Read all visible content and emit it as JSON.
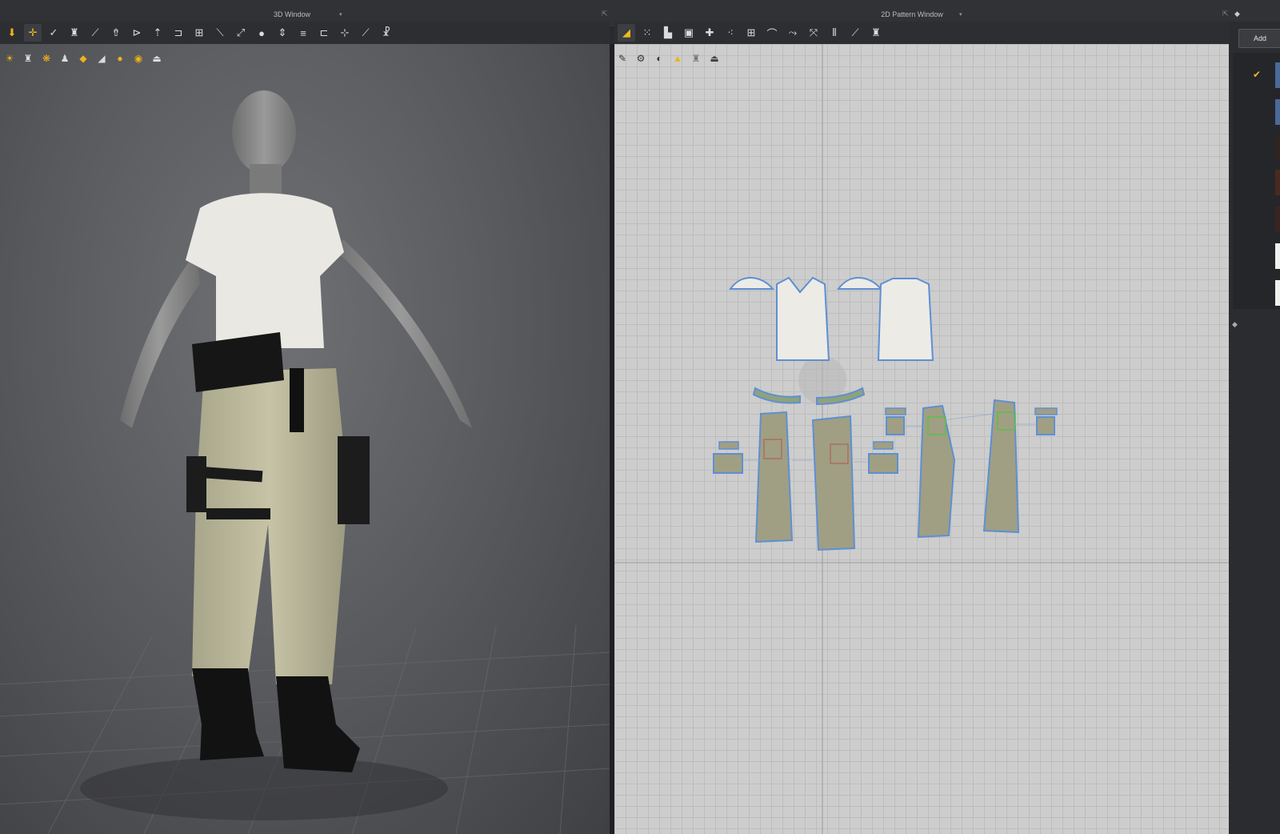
{
  "window_titles": {
    "left": "3D Window",
    "right": "2D Pattern Window"
  },
  "toolbar_3d": [
    "move-icon",
    "select-icon",
    "pen-icon",
    "garment-icon",
    "line-icon",
    "fold-icon",
    "tack-icon",
    "pin-icon",
    "hang-icon",
    "grid-icon",
    "edit-icon",
    "transform-icon",
    "point-icon",
    "measure-icon",
    "tape-icon",
    "bar-icon",
    "split-icon",
    "brush-icon",
    "avatar-pose-icon"
  ],
  "toolbar_2d": [
    "pattern-select-icon",
    "points-icon",
    "rectangle-icon",
    "internal-shape-icon",
    "grain-icon",
    "sew-icon",
    "grid-icon",
    "curve-icon",
    "fold-icon",
    "stitch-icon",
    "bars-icon",
    "measure-icon",
    "shirt-icon"
  ],
  "sidebar": {
    "add_label": "Add",
    "swatches": [
      "#4a6a9a",
      "#4a6a9a",
      "#2f2420",
      "#4a2a20",
      "#3a2420",
      "#f0f0ee",
      "#f0f0ee"
    ]
  }
}
